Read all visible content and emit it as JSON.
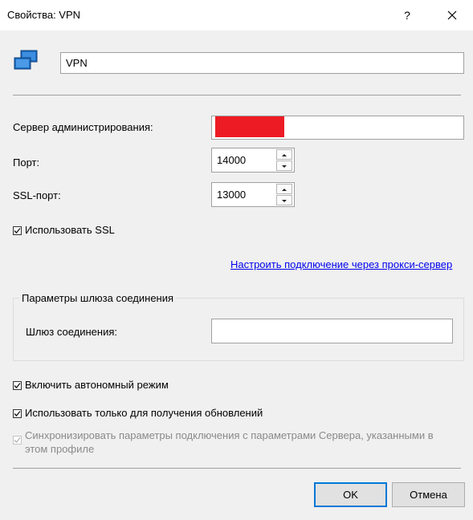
{
  "dialog": {
    "title": "Свойства: VPN",
    "help_symbol": "?",
    "close_symbol": "×"
  },
  "profile": {
    "icon": "network-connection-icon",
    "name": "VPN"
  },
  "server": {
    "label": "Сервер администрирования:",
    "value_redacted": true,
    "redaction_color": "#ed1c24"
  },
  "port": {
    "label": "Порт:",
    "value": "14000"
  },
  "ssl_port": {
    "label": "SSL-порт:",
    "value": "13000"
  },
  "use_ssl": {
    "label": "Использовать SSL",
    "checked": true
  },
  "proxy_link": "Настроить подключение через прокси-сервер",
  "gateway_group": {
    "title": "Параметры шлюза соединения",
    "field_label": "Шлюз соединения:",
    "field_value": ""
  },
  "offline_mode": {
    "label": "Включить автономный режим",
    "checked": true
  },
  "updates_only": {
    "label": "Использовать только для получения обновлений",
    "checked": true
  },
  "sync_params": {
    "label_line1": "Синхронизировать параметры подключения с параметрами Сервера, указанными в",
    "label_line2": "этом профиле",
    "checked": true,
    "disabled": true
  },
  "buttons": {
    "ok": "OK",
    "cancel": "Отмена"
  },
  "colors": {
    "link": "#0000ee",
    "accent": "#0078d7",
    "disabled_text": "#8a8a8a"
  }
}
